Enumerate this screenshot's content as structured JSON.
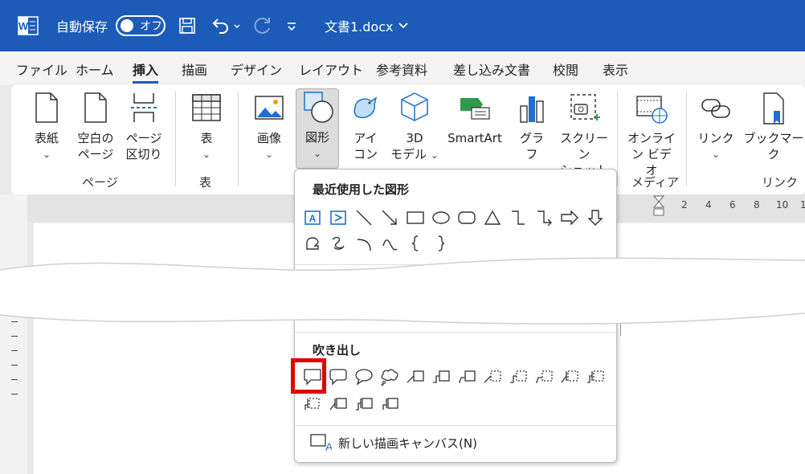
{
  "titlebar": {
    "autosave_label": "自動保存",
    "autosave_state": "オフ",
    "document_title": "文書1.docx",
    "chevron": "⌄",
    "qat_more": "⌄"
  },
  "menu": {
    "items": [
      {
        "label": "ファイル",
        "active": false
      },
      {
        "label": "ホーム",
        "active": false
      },
      {
        "label": "挿入",
        "active": true
      },
      {
        "label": "描画",
        "active": false
      },
      {
        "label": "デザイン",
        "active": false
      },
      {
        "label": "レイアウト",
        "active": false
      },
      {
        "label": "参考資料",
        "active": false
      },
      {
        "label": "差し込み文書",
        "active": false
      },
      {
        "label": "校閲",
        "active": false
      },
      {
        "label": "表示",
        "active": false
      }
    ]
  },
  "ribbon": {
    "buttons": [
      {
        "id": "cover",
        "line1": "表紙",
        "line2": "",
        "chevron": "⌄",
        "icon": "cover-page-icon"
      },
      {
        "id": "blank",
        "line1": "空白の",
        "line2": "ページ",
        "chevron": "",
        "icon": "blank-page-icon"
      },
      {
        "id": "pagebreak",
        "line1": "ページ",
        "line2": "区切り",
        "chevron": "",
        "icon": "page-break-icon"
      },
      {
        "id": "table",
        "line1": "表",
        "line2": "",
        "chevron": "⌄",
        "icon": "table-icon"
      },
      {
        "id": "image",
        "line1": "画像",
        "line2": "",
        "chevron": "⌄",
        "icon": "image-icon"
      },
      {
        "id": "shapes",
        "line1": "図形",
        "line2": "",
        "chevron": "⌄",
        "icon": "shapes-icon"
      },
      {
        "id": "icons",
        "line1": "アイ",
        "line2": "コン",
        "chevron": "",
        "icon": "bird-icon"
      },
      {
        "id": "model3d",
        "line1": "3D",
        "line2": "モデル",
        "chevron": "⌄",
        "icon": "cube-icon"
      },
      {
        "id": "smartart",
        "line1": "SmartArt",
        "line2": "",
        "chevron": "",
        "icon": "smartart-icon"
      },
      {
        "id": "chart",
        "line1": "グラフ",
        "line2": "",
        "chevron": "",
        "icon": "chart-icon"
      },
      {
        "id": "screenshot",
        "line1": "スクリーン",
        "line2": "ショット",
        "chevron": "⌄",
        "icon": "screenshot-icon"
      },
      {
        "id": "onlinevideo",
        "line1": "オンライ",
        "line2": "ン ビデオ",
        "chevron": "",
        "icon": "online-video-icon"
      },
      {
        "id": "link",
        "line1": "リンク",
        "line2": "",
        "chevron": "⌄",
        "icon": "link-icon"
      },
      {
        "id": "bookmark",
        "line1": "ブックマーク",
        "line2": "",
        "chevron": "",
        "icon": "bookmark-icon"
      }
    ],
    "groups": [
      {
        "label": "ページ"
      },
      {
        "label": "表"
      },
      {
        "label": "メディア"
      },
      {
        "label": "リンク"
      }
    ]
  },
  "ruler": {
    "marks": [
      "2",
      "4",
      "6",
      "8",
      "10",
      "1"
    ]
  },
  "shapes_menu": {
    "recent_heading": "最近使用した図形",
    "callouts_heading": "吹き出し",
    "new_canvas_label": "新しい描画キャンバス(N)",
    "accent_color": "#1e6fd0",
    "highlight_color": "#e00000"
  }
}
